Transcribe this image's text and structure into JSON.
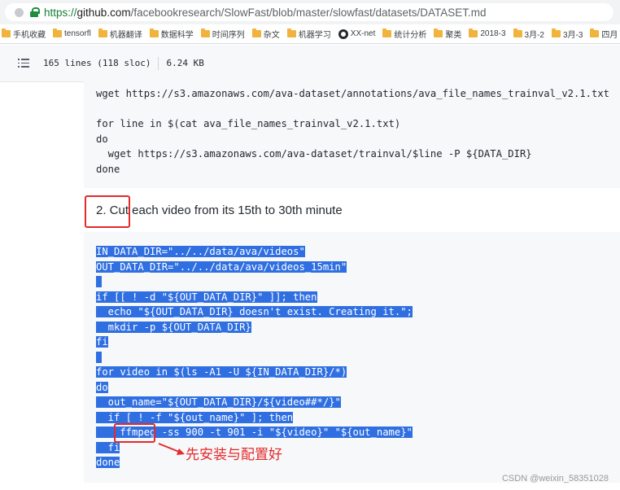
{
  "browser": {
    "url": {
      "scheme": "https://",
      "host": "github.com",
      "path": "/facebookresearch/SlowFast/blob/master/slowfast/datasets/DATASET.md"
    },
    "bookmarks": [
      {
        "label": "手机收藏",
        "icon": "folder-icon"
      },
      {
        "label": "tensorfl",
        "icon": "folder-icon"
      },
      {
        "label": "机器翻译",
        "icon": "folder-icon"
      },
      {
        "label": "数据科学",
        "icon": "folder-icon"
      },
      {
        "label": "时间序列",
        "icon": "folder-icon"
      },
      {
        "label": "杂文",
        "icon": "folder-icon"
      },
      {
        "label": "机器学习",
        "icon": "folder-icon"
      },
      {
        "label": "XX-net",
        "icon": "github-icon"
      },
      {
        "label": "统计分析",
        "icon": "folder-icon"
      },
      {
        "label": "聚类",
        "icon": "folder-icon"
      },
      {
        "label": "2018-3",
        "icon": "folder-icon"
      },
      {
        "label": "3月-2",
        "icon": "folder-icon"
      },
      {
        "label": "3月-3",
        "icon": "folder-icon"
      },
      {
        "label": "四月",
        "icon": "folder-icon"
      }
    ]
  },
  "file_header": {
    "lines": "165 lines (118 sloc)",
    "size": "6.24 KB"
  },
  "code_block_1": [
    "wget https://s3.amazonaws.com/ava-dataset/annotations/ava_file_names_trainval_v2.1.txt",
    "",
    "for line in $(cat ava_file_names_trainval_v2.1.txt)",
    "do",
    "  wget https://s3.amazonaws.com/ava-dataset/trainval/$line -P ${DATA_DIR}",
    "done"
  ],
  "heading": "2. Cut each video from its 15th to 30th minute",
  "code_block_2": [
    "IN_DATA_DIR=\"../../data/ava/videos\"",
    "OUT_DATA_DIR=\"../../data/ava/videos_15min\"",
    "",
    "if [[ ! -d \"${OUT_DATA_DIR}\" ]]; then",
    "  echo \"${OUT_DATA_DIR} doesn't exist. Creating it.\";",
    "  mkdir -p ${OUT_DATA_DIR}",
    "fi",
    "",
    "for video in $(ls -A1 -U ${IN_DATA_DIR}/*)",
    "do",
    "  out_name=\"${OUT_DATA_DIR}/${video##*/}\"",
    "  if [ ! -f \"${out_name}\" ]; then",
    "    ffmpeg -ss 900 -t 901 -i \"${video}\" \"${out_name}\"",
    "  fi",
    "done"
  ],
  "annotation": "先安装与配置好",
  "watermark": "CSDN @weixin_58351028",
  "colors": {
    "selection": "#2f6fe1",
    "annotation_red": "#e52a2a",
    "code_bg": "#f6f8fa"
  }
}
